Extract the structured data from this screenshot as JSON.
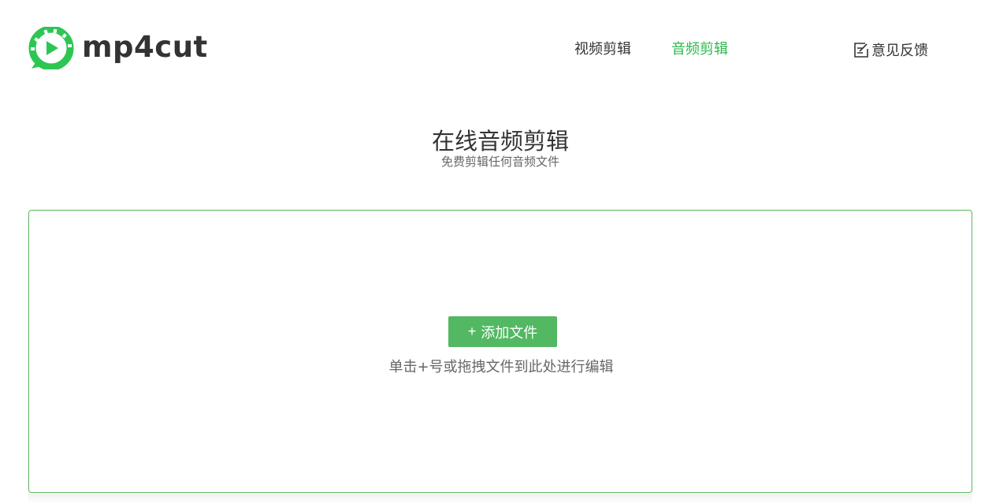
{
  "header": {
    "logo_text": "mp4cut",
    "nav": [
      {
        "label": "视频剪辑",
        "active": false
      },
      {
        "label": "音频剪辑",
        "active": true
      }
    ],
    "feedback_label": "意见反馈"
  },
  "hero": {
    "title": "在线音频剪辑",
    "subtitle": "免费剪辑任何音频文件"
  },
  "dropzone": {
    "add_button_icon": "+",
    "add_button_label": "添加文件",
    "hint": "单击+号或拖拽文件到此处进行编辑"
  },
  "colors": {
    "accent": "#2db84d",
    "button": "#52b862",
    "border": "#5cb85c",
    "text": "#333333",
    "muted": "#666666"
  }
}
